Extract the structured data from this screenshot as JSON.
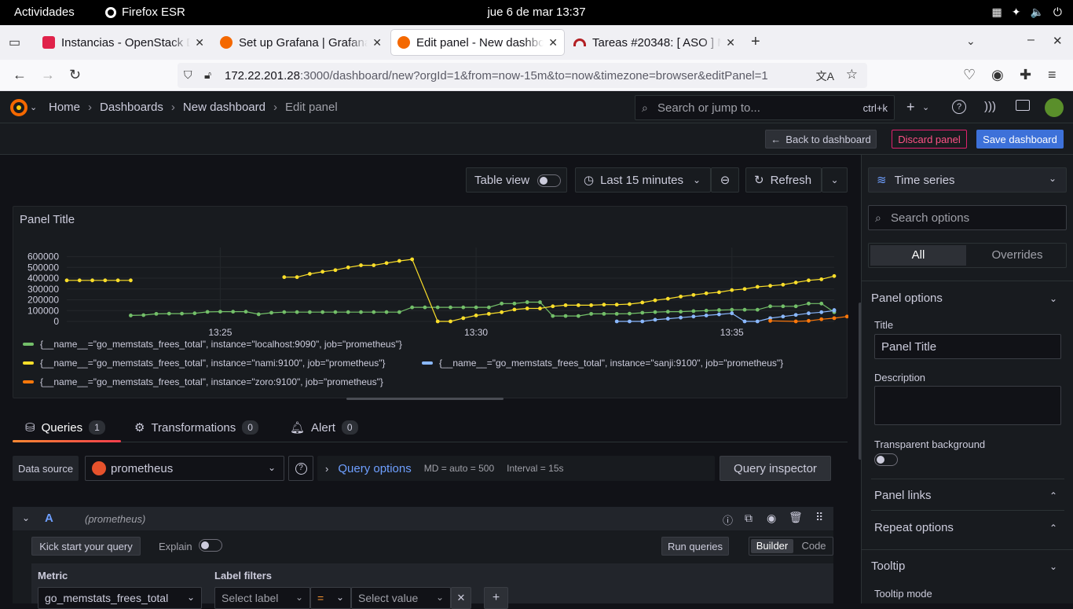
{
  "gnome": {
    "activities": "Actividades",
    "app": "Firefox ESR",
    "clock": "jue   6 de mar  13:37"
  },
  "browser": {
    "tabs": [
      {
        "title": "Instancias - OpenStack Da"
      },
      {
        "title": "Set up Grafana | Grafana d"
      },
      {
        "title": "Edit panel - New dashboa"
      },
      {
        "title": "Tareas #20348: [ ASO ] M"
      }
    ],
    "url_host": "172.22.201.28",
    "url_rest": ":3000/dashboard/new?orgId=1&from=now-15m&to=now&timezone=browser&editPanel=1"
  },
  "grafana": {
    "breadcrumbs": [
      "Home",
      "Dashboards",
      "New dashboard",
      "Edit panel"
    ],
    "search_placeholder": "Search or jump to...",
    "search_shortcut": "ctrl+k",
    "toolbar": {
      "back": "Back to dashboard",
      "discard": "Discard panel",
      "save": "Save dashboard"
    },
    "panel_controls": {
      "table_view": "Table view",
      "time_range": "Last 15 minutes",
      "refresh": "Refresh"
    },
    "panel_title": "Panel Title",
    "query_tabs": [
      {
        "label": "Queries",
        "count": "1"
      },
      {
        "label": "Transformations",
        "count": "0"
      },
      {
        "label": "Alert",
        "count": "0"
      }
    ],
    "query": {
      "data_source_label": "Data source",
      "data_source": "prometheus",
      "query_options": "Query options",
      "query_meta": "MD = auto = 500",
      "interval": "Interval = 15s",
      "inspector": "Query inspector",
      "ref_id": "A",
      "ref_ds": "(prometheus)",
      "kickstart": "Kick start your query",
      "explain": "Explain",
      "run": "Run queries",
      "builder": "Builder",
      "code": "Code",
      "metric_label": "Metric",
      "metric_value": "go_memstats_frees_total",
      "label_filters": "Label filters",
      "select_label": "Select label",
      "operator": "=",
      "select_value": "Select value"
    },
    "options": {
      "viz": "Time series",
      "search": "Search options",
      "tab_all": "All",
      "tab_overrides": "Overrides",
      "panel_options": "Panel options",
      "title_label": "Title",
      "title_value": "Panel Title",
      "description_label": "Description",
      "transparent_label": "Transparent background",
      "panel_links": "Panel links",
      "repeat_options": "Repeat options",
      "tooltip": "Tooltip",
      "tooltip_mode": "Tooltip mode"
    }
  },
  "chart_data": {
    "type": "line",
    "title": "Panel Title",
    "ylim": [
      0,
      650000
    ],
    "y_ticks": [
      "600000",
      "500000",
      "400000",
      "300000",
      "200000",
      "100000",
      "0"
    ],
    "x_ticks": [
      "13:25",
      "13:30",
      "13:35"
    ],
    "xlim_minutes": [
      "13:22:00",
      "13:37:00"
    ],
    "series": [
      {
        "name": "{__name__=\"go_memstats_frees_total\", instance=\"localhost:9090\", job=\"prometheus\"}",
        "color": "#73bf69",
        "x": [
          "13:23:15",
          "13:23:30",
          "13:23:45",
          "13:24:00",
          "13:24:15",
          "13:24:30",
          "13:24:45",
          "13:25:00",
          "13:25:15",
          "13:25:30",
          "13:25:45",
          "13:26:00",
          "13:26:15",
          "13:26:30",
          "13:26:45",
          "13:27:00",
          "13:27:15",
          "13:27:30",
          "13:27:45",
          "13:28:00",
          "13:28:15",
          "13:28:30",
          "13:28:45",
          "13:29:00",
          "13:29:15",
          "13:29:30",
          "13:29:45",
          "13:30:00",
          "13:30:15",
          "13:30:30",
          "13:30:45",
          "13:31:00",
          "13:31:15",
          "13:31:30",
          "13:31:45",
          "13:32:00",
          "13:32:15",
          "13:32:30",
          "13:32:45",
          "13:33:00",
          "13:33:15",
          "13:33:30",
          "13:33:45",
          "13:34:00",
          "13:34:15",
          "13:34:30",
          "13:34:45",
          "13:35:00",
          "13:35:15",
          "13:35:30",
          "13:35:45",
          "13:36:00",
          "13:36:15",
          "13:36:30",
          "13:36:45",
          "13:37:00"
        ],
        "y": [
          55000,
          58000,
          70000,
          72000,
          72000,
          75000,
          88000,
          90000,
          90000,
          90000,
          66000,
          80000,
          86000,
          86000,
          86000,
          86000,
          86000,
          86000,
          86000,
          86000,
          86000,
          86000,
          130000,
          130000,
          130000,
          130000,
          130000,
          130000,
          130000,
          165000,
          165000,
          178000,
          178000,
          50000,
          50000,
          50000,
          70000,
          70000,
          70000,
          72000,
          80000,
          86000,
          90000,
          90000,
          95000,
          100000,
          105000,
          108000,
          108000,
          108000,
          140000,
          140000,
          140000,
          165000,
          165000,
          85000
        ]
      },
      {
        "name": "{__name__=\"go_memstats_frees_total\", instance=\"nami:9100\", job=\"prometheus\"}",
        "color": "#fade2a",
        "x": [
          "13:22:00",
          "13:22:15",
          "13:22:30",
          "13:22:45",
          "13:23:00",
          "13:23:15",
          "13:26:15",
          "13:26:30",
          "13:26:45",
          "13:27:00",
          "13:27:15",
          "13:27:30",
          "13:27:45",
          "13:28:00",
          "13:28:15",
          "13:28:30",
          "13:28:45",
          "13:29:15",
          "13:29:30",
          "13:29:45",
          "13:30:00",
          "13:30:15",
          "13:30:30",
          "13:30:45",
          "13:31:00",
          "13:31:15",
          "13:31:30",
          "13:31:45",
          "13:32:00",
          "13:32:15",
          "13:32:30",
          "13:32:45",
          "13:33:00",
          "13:33:15",
          "13:33:30",
          "13:33:45",
          "13:34:00",
          "13:34:15",
          "13:34:30",
          "13:34:45",
          "13:35:00",
          "13:35:15",
          "13:35:30",
          "13:35:45",
          "13:36:00",
          "13:36:15",
          "13:36:30",
          "13:36:45",
          "13:37:00"
        ],
        "y": [
          380000,
          380000,
          380000,
          380000,
          380000,
          380000,
          410000,
          410000,
          440000,
          460000,
          475000,
          500000,
          520000,
          520000,
          540000,
          560000,
          575000,
          0,
          0,
          30000,
          55000,
          70000,
          85000,
          110000,
          120000,
          120000,
          140000,
          150000,
          150000,
          150000,
          155000,
          155000,
          160000,
          175000,
          195000,
          210000,
          230000,
          245000,
          260000,
          270000,
          290000,
          300000,
          320000,
          330000,
          340000,
          360000,
          380000,
          390000,
          420000
        ]
      },
      {
        "name": "{__name__=\"go_memstats_frees_total\", instance=\"sanji:9100\", job=\"prometheus\"}",
        "color": "#8ab8ff",
        "x": [
          "13:32:45",
          "13:33:00",
          "13:33:15",
          "13:33:30",
          "13:33:45",
          "13:34:00",
          "13:34:15",
          "13:34:30",
          "13:34:45",
          "13:35:00",
          "13:35:15",
          "13:35:30",
          "13:35:45",
          "13:36:00",
          "13:36:15",
          "13:36:30",
          "13:36:45",
          "13:37:00",
          "13:37:00"
        ],
        "y": [
          0,
          0,
          0,
          15000,
          25000,
          35000,
          45000,
          55000,
          65000,
          75000,
          0,
          0,
          30000,
          45000,
          60000,
          75000,
          85000,
          100000,
          105000
        ]
      },
      {
        "name": "{__name__=\"go_memstats_frees_total\", instance=\"zoro:9100\", job=\"prometheus\"}",
        "color": "#ff780a",
        "x": [
          "13:35:45",
          "13:36:15",
          "13:36:30",
          "13:36:45",
          "13:37:00",
          "13:37:15"
        ],
        "y": [
          5000,
          0,
          5000,
          20000,
          30000,
          45000
        ]
      }
    ],
    "legend_placement": "bottom",
    "grid": true
  }
}
